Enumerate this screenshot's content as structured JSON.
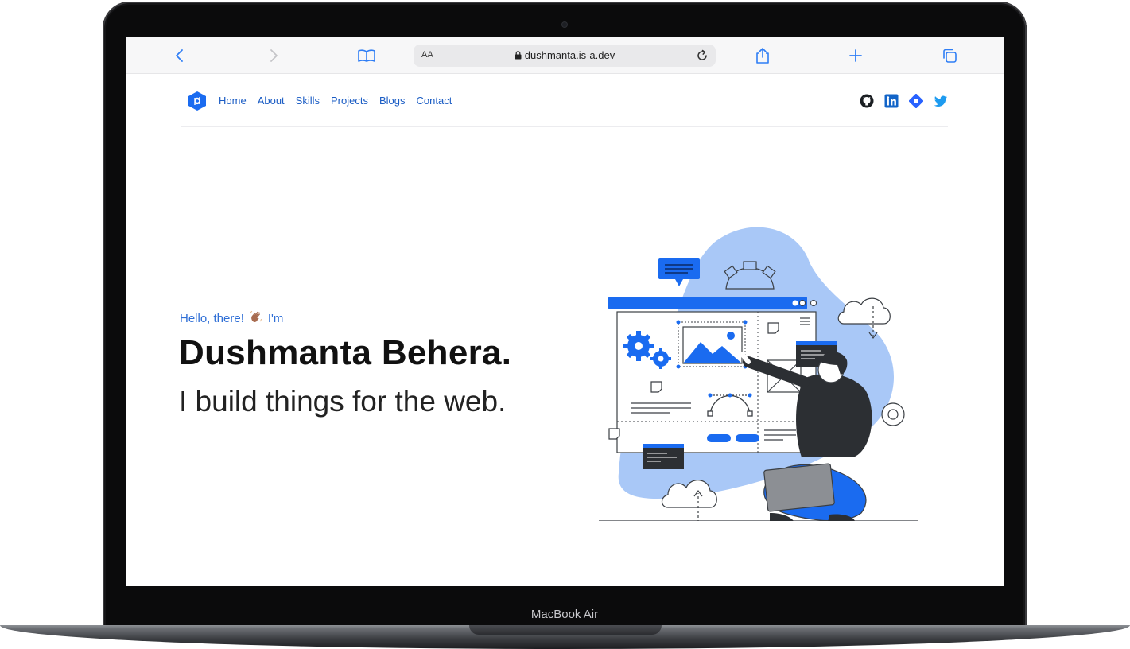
{
  "device": {
    "label": "MacBook Air"
  },
  "browser": {
    "text_size_label": "AA",
    "url": "dushmanta.is-a.dev",
    "icons": [
      "back-icon",
      "forward-icon",
      "bookmarks-icon",
      "lock-icon",
      "reload-icon",
      "share-icon",
      "new-tab-icon",
      "tabs-icon"
    ]
  },
  "nav": {
    "links": [
      "Home",
      "About",
      "Skills",
      "Projects",
      "Blogs",
      "Contact"
    ],
    "socials": [
      "github-icon",
      "linkedin-icon",
      "hashnode-icon",
      "twitter-icon"
    ]
  },
  "hero": {
    "greeting": "Hello, there!",
    "greeting_suffix": "I'm",
    "name": "Dushmanta Behera.",
    "tagline": "I build things for the web."
  },
  "colors": {
    "accent": "#1a6bf0",
    "link": "#1a5cc4",
    "blob": "#a9c8f7",
    "dark": "#2c2f33"
  }
}
